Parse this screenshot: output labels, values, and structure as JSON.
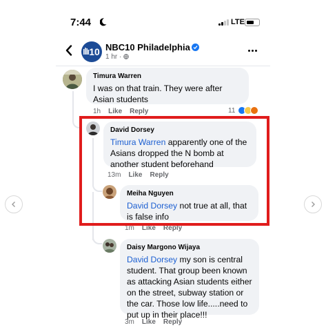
{
  "status_bar": {
    "time": "7:44",
    "network": "LTE"
  },
  "post_header": {
    "page_name": "NBC10 Philadelphia",
    "avatar_text": "10",
    "meta": "1 hr ·"
  },
  "comments": [
    {
      "author": "Timura Warren",
      "text": "I was on that train. They were after Asian students",
      "time": "1h",
      "like": "Like",
      "reply": "Reply",
      "reaction_count": "11"
    },
    {
      "author": "David Dorsey",
      "mention": "Timura Warren",
      "text": " apparently one of the Asians dropped the N bomb at another student beforehand",
      "time": "13m",
      "like": "Like",
      "reply": "Reply"
    },
    {
      "author": "Meiha Nguyen",
      "mention": "David Dorsey",
      "text": " not true at all, that is false info",
      "time": "1m",
      "like": "Like",
      "reply": "Reply"
    },
    {
      "author": "Daisy Margono Wijaya",
      "mention": "David Dorsey",
      "text": " my son is central student. That group been known as attacking Asian students either on the street, subway station or the car. Those low life.....need to put up in their place!!!",
      "time": "3m",
      "like": "Like",
      "reply": "Reply"
    }
  ],
  "colors": {
    "highlight_border": "#e01c1c",
    "mention": "#1c5fd1",
    "bubble": "#f0f2f5"
  },
  "icons": [
    "chevron-left-icon",
    "chevron-right-icon",
    "back-arrow-icon",
    "verified-badge-icon",
    "more-options-icon",
    "moon-icon",
    "signal-icon",
    "battery-icon",
    "like-reaction-icon",
    "haha-reaction-icon",
    "angry-reaction-icon"
  ]
}
